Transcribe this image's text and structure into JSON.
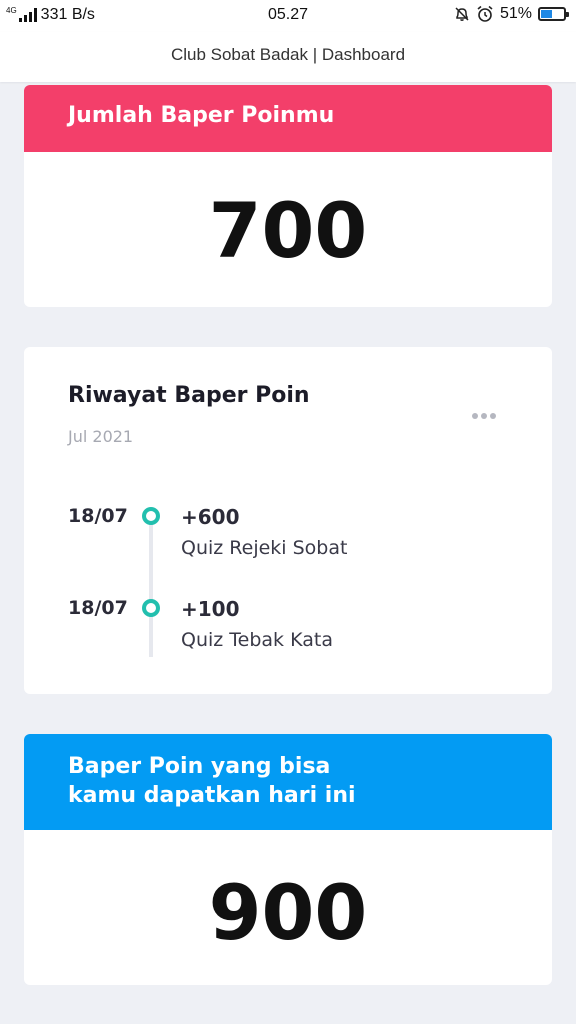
{
  "status_bar": {
    "network_type": "4G",
    "net_speed": "331 B/s",
    "time": "05.27",
    "battery_percent": "51%",
    "battery_level": 0.51,
    "battery_color": "#1e88e5"
  },
  "header": {
    "title": "Club Sobat Badak | Dashboard"
  },
  "points_card": {
    "title": "Jumlah Baper Poinmu",
    "value": "700",
    "accent_color": "#f33f6a"
  },
  "history": {
    "title": "Riwayat Baper Poin",
    "month": "Jul 2021",
    "items": [
      {
        "date": "18/07",
        "points": "+600",
        "desc": "Quiz Rejeki Sobat"
      },
      {
        "date": "18/07",
        "points": "+100",
        "desc": "Quiz Tebak Kata"
      }
    ],
    "dot_color": "#22bfae"
  },
  "today_card": {
    "title_line1": "Baper Poin yang bisa",
    "title_line2": "kamu dapatkan hari ini",
    "value": "900",
    "accent_color": "#039bf3"
  },
  "icons": [
    "signal-icon",
    "mute-bell-icon",
    "alarm-icon",
    "battery-icon",
    "more-dots-icon"
  ]
}
